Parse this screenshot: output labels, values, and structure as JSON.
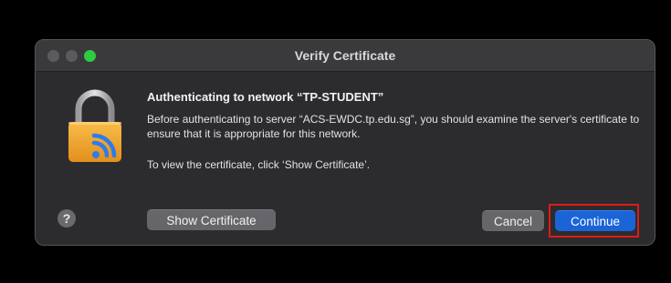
{
  "window": {
    "title": "Verify Certificate"
  },
  "dialog": {
    "heading": "Authenticating to network “TP-STUDENT”",
    "body": "Before authenticating to server “ACS-EWDC.tp.edu.sg”, you should examine the server's certificate to ensure that it is appropriate for this network.",
    "hint": "To view the certificate, click ‘Show Certificate’."
  },
  "buttons": {
    "help_label": "?",
    "show_certificate_label": "Show Certificate",
    "cancel_label": "Cancel",
    "continue_label": "Continue"
  },
  "icons": {
    "main": "lock-wifi-icon",
    "help": "help-icon"
  },
  "colors": {
    "accent": "#1a64d8",
    "highlight": "#e01a1a",
    "lock_body": "#f2a52c",
    "wifi_blue": "#2f7bea"
  }
}
